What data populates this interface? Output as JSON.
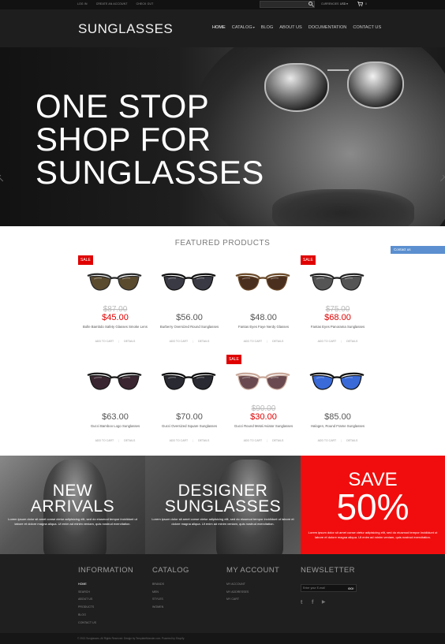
{
  "topbar": {
    "links": [
      "LOG IN",
      "CREATE AN ACCOUNT",
      "CHECK OUT"
    ],
    "currencies_label": "CURRENCIES",
    "currency": "USD",
    "cart_count": "0"
  },
  "header": {
    "logo": "SUNGLASSES",
    "nav": [
      {
        "label": "HOME",
        "active": true
      },
      {
        "label": "CATALOG",
        "dropdown": true
      },
      {
        "label": "BLOG"
      },
      {
        "label": "ABOUT US"
      },
      {
        "label": "DOCUMENTATION"
      },
      {
        "label": "CONTACT US"
      }
    ]
  },
  "hero": {
    "line1": "ONE STOP",
    "line2": "SHOP FOR",
    "line3": "SUNGLASSES"
  },
  "featured": {
    "title": "FEATURED PRODUCTS",
    "contact_tab": "Contact us",
    "sale_label": "SALE",
    "add_to_cart": "ADD TO CART",
    "details": "DETAILS",
    "products": [
      {
        "name": "Bolle Bambdo Safety Glasses Smoke Lens",
        "price": "$45.00",
        "old_price": "$87.00",
        "sale": true,
        "lens": "#5a4a2e",
        "frame": "#2a2a2a"
      },
      {
        "name": "Burberry Oversized Round Sunglasses",
        "price": "$56.00",
        "old_price": "",
        "sale": false,
        "lens": "#3a3a44",
        "frame": "#111111"
      },
      {
        "name": "Fantas Eyes Faye Nerdy Glasses",
        "price": "$48.00",
        "old_price": "",
        "sale": false,
        "lens": "#4a2e1e",
        "frame": "#6a4a2a"
      },
      {
        "name": "Fantas Eyes Panorama Sunglasses",
        "price": "$68.00",
        "old_price": "$75.00",
        "sale": true,
        "lens": "#555555",
        "frame": "#222222"
      },
      {
        "name": "Gucci Bamboo Logo Sunglasses",
        "price": "$63.00",
        "old_price": "",
        "sale": false,
        "lens": "#3a2630",
        "frame": "#1a1a1a"
      },
      {
        "name": "Gucci Oversized Square Sunglasses",
        "price": "$70.00",
        "old_price": "",
        "sale": false,
        "lens": "#2a2a32",
        "frame": "#0e0e0e"
      },
      {
        "name": "Gucci Round Metal Aviator Sunglasses",
        "price": "$30.00",
        "old_price": "$90.00",
        "sale": true,
        "lens": "#6a4a50",
        "frame": "#c9a89a"
      },
      {
        "name": "Halogen, Round Frame Sunglasses",
        "price": "$85.00",
        "old_price": "",
        "sale": false,
        "lens": "#3a6ad8",
        "frame": "#111111"
      }
    ]
  },
  "promos": {
    "new_line1": "NEW",
    "new_line2": "ARRIVALS",
    "designer_line1": "DESIGNER",
    "designer_line2": "SUNGLASSES",
    "text": "Lorem ipsum dolor sit amet conse ctetur adipisicing elit, sed do eiusmod tempor incididunt ut labore et dolore magna aliqua. Ut enim ad minim veniam, quis nostrud exercitation.",
    "save_title": "SAVE",
    "save_pct": "50%"
  },
  "footer": {
    "information": {
      "title": "INFORMATION",
      "items": [
        "HOME",
        "SEARCH",
        "ABOUT US",
        "PRODUCTS",
        "BLOG",
        "CONTACT US"
      ]
    },
    "catalog": {
      "title": "CATALOG",
      "items": [
        "BRANDS",
        "MEN",
        "STYLES",
        "WOMEN"
      ]
    },
    "account": {
      "title": "MY ACCOUNT",
      "items": [
        "MY ACCOUNT",
        "MY ADDRESSES",
        "MY CART"
      ]
    },
    "newsletter": {
      "title": "NEWSLETTER",
      "placeholder": "Enter your E-mail",
      "button": "GO!"
    },
    "social": [
      "t",
      "f",
      "▶"
    ],
    "copyright": "© 2013 Sunglasses. All Rights Reserved. Design by TemplateMonster.com. Powered by Shopify."
  }
}
